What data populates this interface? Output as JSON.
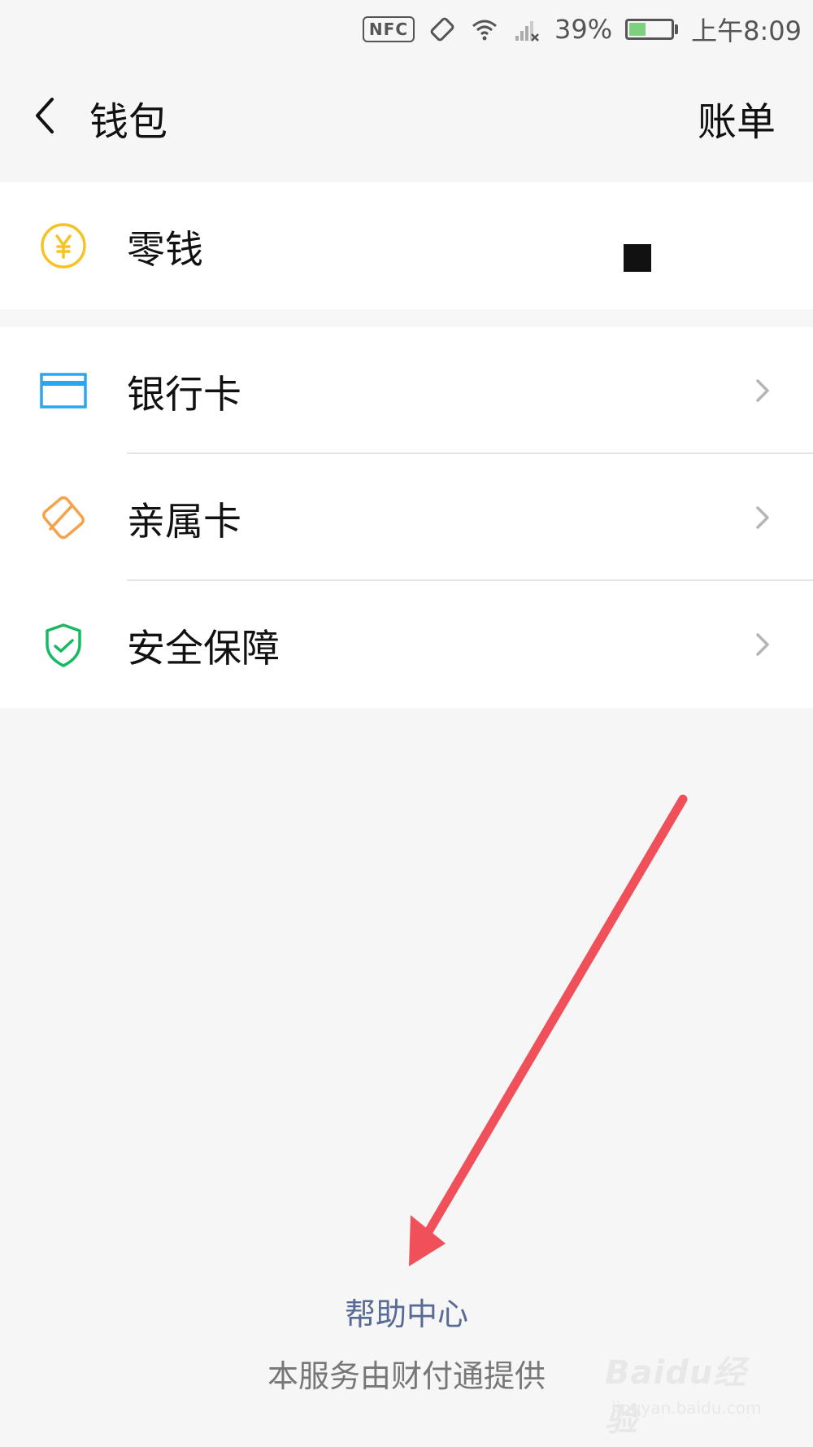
{
  "status_bar": {
    "nfc": "NFC",
    "battery_percent": "39%",
    "battery_level": 0.39,
    "time": "上午8:09"
  },
  "navbar": {
    "back_icon": "chevron-left-icon",
    "title": "钱包",
    "right_label": "账单"
  },
  "groups": [
    {
      "items": [
        {
          "label": "零钱",
          "icon": "yuan-coin-icon",
          "color": "#f6c324"
        }
      ]
    },
    {
      "items": [
        {
          "label": "银行卡",
          "icon": "bank-card-icon",
          "color": "#2aa6f0"
        },
        {
          "label": "亲属卡",
          "icon": "family-card-icon",
          "color": "#f6a24a"
        },
        {
          "label": "安全保障",
          "icon": "shield-check-icon",
          "color": "#15ba61"
        }
      ]
    }
  ],
  "annotation": {
    "arrow_color": "#f0505a"
  },
  "footer": {
    "help_link": "帮助中心",
    "provider_text": "本服务由财付通提供"
  },
  "watermark": {
    "text": "Baidu经验",
    "subtext": "jingyan.baidu.com"
  },
  "colors": {
    "link": "#576b95",
    "background": "#f6f6f6"
  }
}
